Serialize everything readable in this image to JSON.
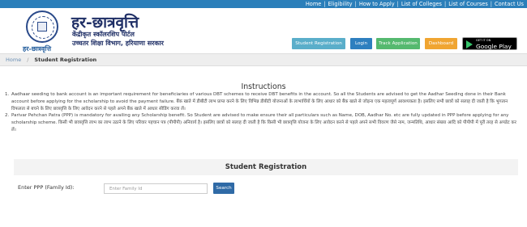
{
  "top_nav": {
    "links": [
      "Home",
      "Eligibility",
      "How to Apply",
      "List of Colleges",
      "List of Courses",
      "Contact Us"
    ],
    "separator": "|"
  },
  "header": {
    "title": "हर-छात्रवृत्ति",
    "subtitle_1": "केंद्रीकृत स्कॉलरशिप पोर्टल",
    "subtitle_2": "उच्चतर शिक्षा विभाग, हरियाणा सरकार",
    "logo_caption": "हर-छात्रवृत्ति",
    "buttons": {
      "student_registration": "Student Registration",
      "login": "Login",
      "track_application": "Track Application",
      "dashboard": "Dashboard"
    },
    "google_play": {
      "small": "GET IT ON",
      "big": "Google Play"
    }
  },
  "breadcrumb": {
    "home": "Home",
    "separator": "/",
    "current": "Student Registration"
  },
  "instructions": {
    "title": "Instructions",
    "items": [
      {
        "num": "1.",
        "text": "Aadhaar seeding to bank account is an important requirement for beneficiaries of various DBT schemes to receive DBT benefits in the account. So all the Students are advised to get the Aadhar Seeding done in their Bank account before applying for the scholarship to avoid the payment failure. बैंक खाते में डीबीटी लाभ प्राप्त करने के लिए विभिन्न डीबीटी योजनाओं के लाभार्थियों के लिए आधार को बैंक खाते से जोड़ना एक महत्वपूर्ण आवश्यकता है। इसलिए सभी छात्रों को सलाह दी जाती है कि भुगतान विफलता से बचने के लिए छात्रवृत्ति के लिए आवेदन करने से पहले अपने बैंक खाते में आधार सीडिंग करवा लें।"
      },
      {
        "num": "2.",
        "text": "Parivar Pehchan Patra (PPP) is mandatory for availing any Scholarship benefit. So Student are advised to make ensure their all particulars such as Name, DOB, Aadhar No. etc are fully updated in PPP before applying for any scholarship scheme. किसी भी छात्रवृत्ति लाभ का लाभ उठाने के लिए परिवार पहचान पत्र (पीपीपी) अनिवार्य है। इसलिए छात्रों को सलाह दी जाती है कि किसी भी छात्रवृत्ति योजना के लिए आवेदन करने से पहले अपने सभी विवरण जैसे नाम, जन्मतिथि, आधार संख्या आदि को पीपीपी में पूरी तरह से अपडेट कर लें।"
      }
    ]
  },
  "registration": {
    "panel_title": "Student Registration",
    "ppp_label": "Enter PPP (Family Id):",
    "ppp_placeholder": "Enter Family Id",
    "ppp_value": "",
    "search_label": "Search"
  },
  "colors": {
    "topbar": "#2b7fba",
    "student_registration": "#5aaeca",
    "login": "#2e7fbf",
    "track_application": "#55b96f",
    "dashboard": "#f0a531",
    "search": "#2f6aa6"
  },
  "icons": [
    "emblem-logo",
    "google-play-icon"
  ]
}
